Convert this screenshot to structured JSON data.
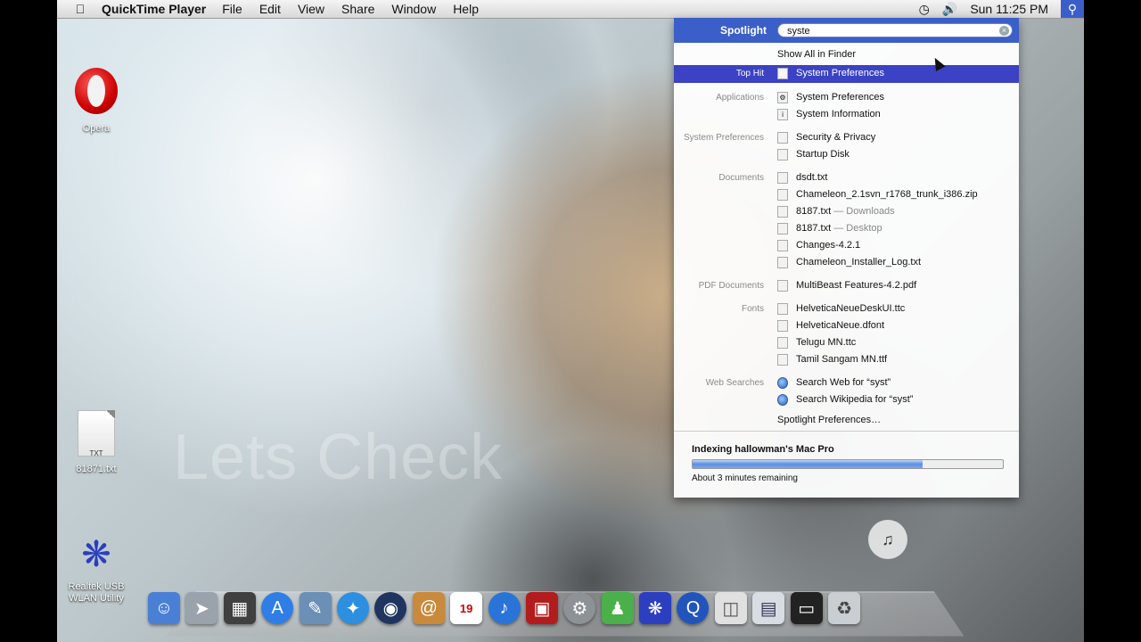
{
  "menubar": {
    "app_name": "QuickTime Player",
    "menus": [
      "File",
      "Edit",
      "View",
      "Share",
      "Window",
      "Help"
    ],
    "clock": "Sun 11:25 PM"
  },
  "desktop": {
    "icons": [
      {
        "label": "Opera"
      },
      {
        "label": "81871.txt",
        "doc_tag": "TXT"
      },
      {
        "label": "Realtek USB WLAN Utility"
      }
    ],
    "watermark": "Lets Check"
  },
  "spotlight": {
    "title": "Spotlight",
    "query": "syste",
    "show_all": "Show All in Finder",
    "top_hit": {
      "category": "Top Hit",
      "label": "System Preferences"
    },
    "groups": [
      {
        "category": "Applications",
        "items": [
          {
            "label": "System Preferences"
          },
          {
            "label": "System Information"
          }
        ]
      },
      {
        "category": "System Preferences",
        "items": [
          {
            "label": "Security & Privacy"
          },
          {
            "label": "Startup Disk"
          }
        ]
      },
      {
        "category": "Documents",
        "items": [
          {
            "label": "dsdt.txt"
          },
          {
            "label": "Chameleon_2.1svn_r1768_trunk_i386.zip"
          },
          {
            "label": "8187.txt",
            "sub": " — Downloads"
          },
          {
            "label": "8187.txt",
            "sub": " — Desktop"
          },
          {
            "label": "Changes-4.2.1"
          },
          {
            "label": "Chameleon_Installer_Log.txt"
          }
        ]
      },
      {
        "category": "PDF Documents",
        "items": [
          {
            "label": "MultiBeast Features-4.2.pdf"
          }
        ]
      },
      {
        "category": "Fonts",
        "items": [
          {
            "label": "HelveticaNeueDeskUI.ttc"
          },
          {
            "label": "HelveticaNeue.dfont"
          },
          {
            "label": "Telugu MN.ttc"
          },
          {
            "label": "Tamil Sangam MN.ttf"
          }
        ]
      },
      {
        "category": "Web Searches",
        "items": [
          {
            "label": "Search Web for “syst”"
          },
          {
            "label": "Search Wikipedia for “syst”"
          }
        ]
      }
    ],
    "preferences_link": "Spotlight Preferences…",
    "indexing": {
      "title": "Indexing hallowman's Mac Pro",
      "progress": 0.74,
      "remaining": "About 3 minutes remaining"
    }
  },
  "dock": {
    "icons": [
      "finder-icon",
      "launchpad-icon",
      "photo-booth-icon",
      "app-store-icon",
      "preview-icon",
      "safari-icon",
      "quicktime-icon",
      "address-book-icon",
      "ical-icon",
      "itunes-icon",
      "photo-icon",
      "system-preferences-icon",
      "messenger-icon",
      "realtek-icon",
      "quicktime-blue-icon",
      "archive-icon",
      "document-icon",
      "display-icon",
      "trash-icon"
    ],
    "calendar_day": "19"
  },
  "colors": {
    "spotlight_header": "#3b5fc8",
    "selection": "#3b42c4"
  }
}
